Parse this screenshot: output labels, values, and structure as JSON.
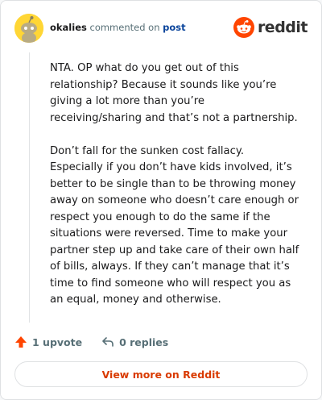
{
  "comment": {
    "username": "okalies",
    "action_text": "commented on",
    "link_text": "post",
    "paragraphs": [
      "NTA. OP what do you get out of this relationship? Because it sounds like you’re giving a lot more than you’re receiving/sharing and that’s not a partnership.",
      "Don’t fall for the sunken cost fallacy. Especially if you don’t have kids involved, it’s better to be single than to be throwing money away on someone who doesn’t care enough or respect you enough to do the same if the situations were reversed. Time to make your partner step up and take care of their own half of bills, always. If they can’t manage that it’s time to find someone who will respect you as an equal, money and otherwise."
    ]
  },
  "brand": {
    "wordmark": "reddit",
    "color": "#ff4500"
  },
  "actions": {
    "upvote_label": "1 upvote",
    "replies_label": "0 replies",
    "upvote_icon": "upvote-arrow-icon",
    "reply_icon": "reply-arrow-icon"
  },
  "footer": {
    "view_more_label": "View more on Reddit"
  },
  "colors": {
    "accent": "#d93a00",
    "upvote": "#ff4500",
    "link": "#0a449b"
  }
}
